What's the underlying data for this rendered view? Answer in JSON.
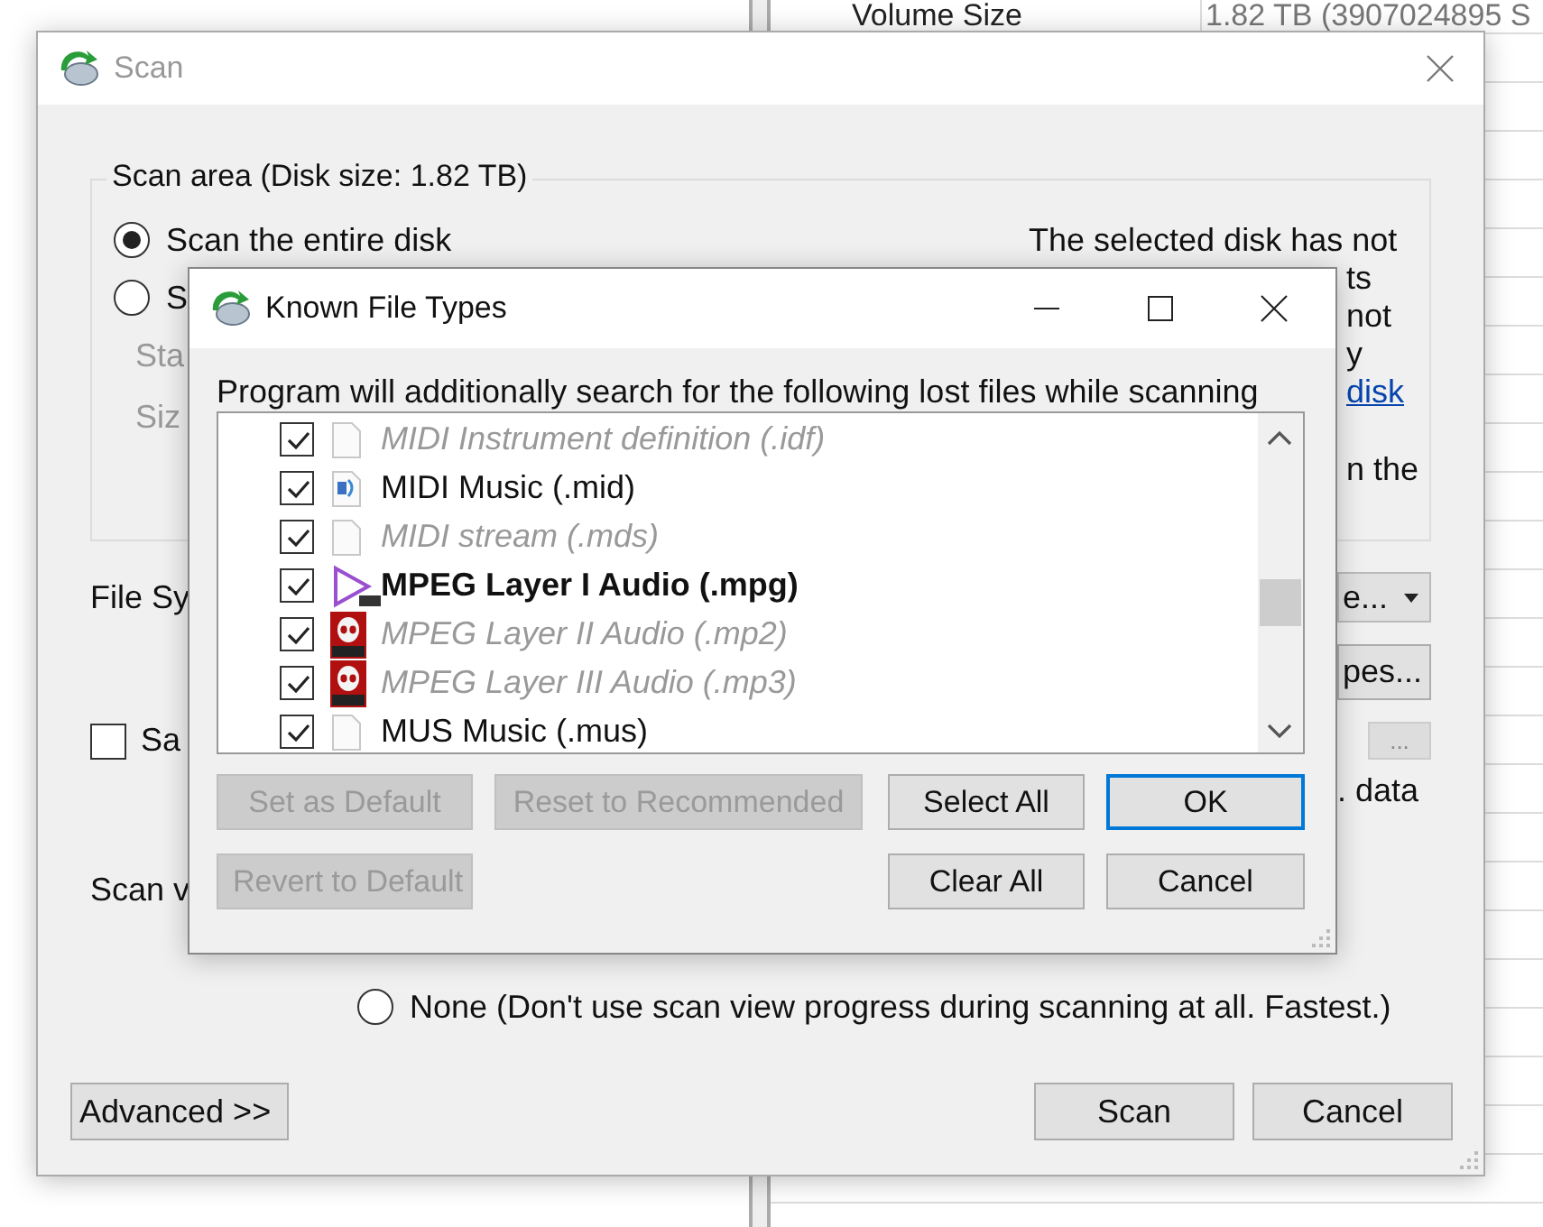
{
  "background_table": {
    "cells": [
      {
        "text": "Volume Size"
      },
      {
        "text": "1.82 TB (3907024895 S"
      }
    ]
  },
  "scan_window": {
    "title": "Scan",
    "scan_area": {
      "legend": "Scan area (Disk size: 1.82 TB)",
      "options": [
        {
          "label": "Scan the entire disk",
          "selected": true
        },
        {
          "label": "S",
          "selected": false
        }
      ],
      "fields": [
        "Sta",
        "Siz"
      ],
      "note_lines": [
        {
          "text": "The selected disk has not",
          "kind": "text"
        },
        {
          "text": "ts",
          "kind": "text"
        },
        {
          "text": "not",
          "kind": "text"
        },
        {
          "text": "y",
          "kind": "text"
        },
        {
          "text": "disk",
          "kind": "link"
        },
        {
          "text": "n the",
          "kind": "gap"
        }
      ]
    },
    "file_system_label": "File Sy",
    "file_system_dropdown": "e...",
    "file_types_button": "pes...",
    "browse_button": "...",
    "save_option": {
      "label": "Sa",
      "checked": false
    },
    "save_note": ". data",
    "scan_view_label": "Scan v",
    "scan_view_option": {
      "label": "None (Don't use scan view progress during scanning at all. Fastest.)",
      "selected": false
    },
    "advanced_button": "Advanced >>",
    "buttons": [
      "Scan",
      "Cancel"
    ]
  },
  "dialog": {
    "title": "Known File Types",
    "description": "Program will additionally search for the following lost files while scanning",
    "rows": [
      {
        "label": "MIDI Instrument definition (.idf)",
        "kind": "plain",
        "checked": true,
        "disabled": true,
        "highlighted": false
      },
      {
        "label": "MIDI Music (.mid)",
        "kind": "music",
        "checked": true,
        "disabled": false,
        "highlighted": false
      },
      {
        "label": "MIDI stream (.mds)",
        "kind": "plain",
        "checked": true,
        "disabled": true,
        "highlighted": false
      },
      {
        "label": "MPEG Layer I Audio (.mpg)",
        "kind": "media",
        "checked": true,
        "disabled": false,
        "highlighted": true
      },
      {
        "label": "MPEG Layer II Audio (.mp2)",
        "kind": "badge",
        "checked": true,
        "disabled": true,
        "highlighted": false
      },
      {
        "label": "MPEG Layer III Audio (.mp3)",
        "kind": "badge",
        "checked": true,
        "disabled": true,
        "highlighted": false
      },
      {
        "label": "MUS Music (.mus)",
        "kind": "plain",
        "checked": true,
        "disabled": false,
        "highlighted": false
      }
    ],
    "button_rows": [
      {
        "left": [
          {
            "label": "Set as Default",
            "disabled": true,
            "default": false
          },
          {
            "label": "Reset to Recommended",
            "disabled": true,
            "default": false
          }
        ],
        "right": [
          {
            "label": "Select All",
            "disabled": false,
            "default": false
          },
          {
            "label": "OK",
            "disabled": false,
            "default": true
          }
        ]
      },
      {
        "left": [
          {
            "label": "Revert to Default",
            "disabled": true,
            "default": false
          }
        ],
        "right": [
          {
            "label": "Clear All",
            "disabled": false,
            "default": false
          },
          {
            "label": "Cancel",
            "disabled": false,
            "default": false
          }
        ]
      }
    ]
  }
}
